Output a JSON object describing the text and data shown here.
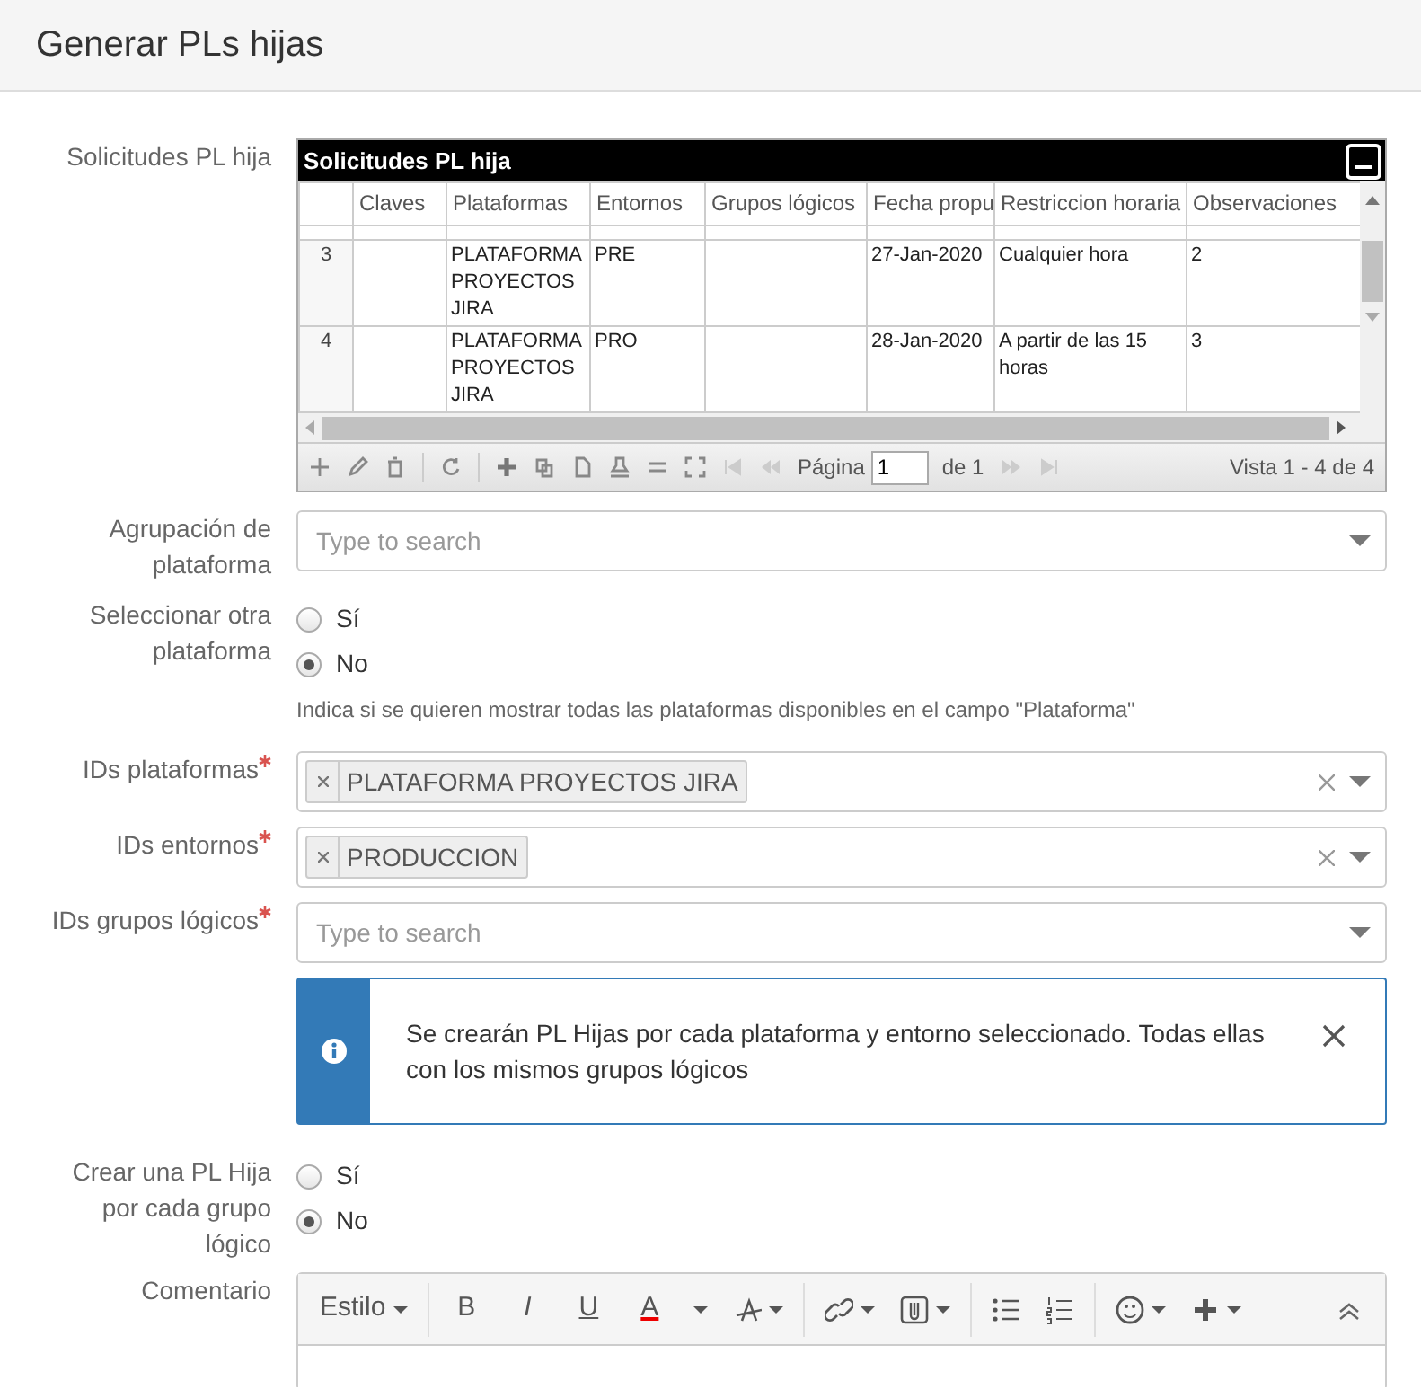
{
  "page_title": "Generar PLs hijas",
  "fields": [
    {
      "kind": "grid",
      "label": "Solicitudes PL hija",
      "required": false,
      "grid": {
        "title": "Solicitudes PL hija",
        "columns": [
          "",
          "Claves",
          "Plataformas",
          "Entornos",
          "Grupos lógicos",
          "Fecha propu",
          "Restriccion horaria",
          "Observaciones"
        ],
        "rows": [
          {
            "cells": [
              "3",
              "",
              "PLATAFORMA PROYECTOS JIRA",
              "PRE",
              "",
              "27-Jan-2020",
              "Cualquier hora",
              "2"
            ]
          },
          {
            "cells": [
              "4",
              "",
              "PLATAFORMA PROYECTOS JIRA",
              "PRO",
              "",
              "28-Jan-2020",
              "A partir de las 15 horas",
              "3"
            ]
          }
        ],
        "pager": {
          "page_label": "Página",
          "page_value": "1",
          "of_label": "de 1",
          "summary": "Vista 1 - 4 de 4"
        }
      }
    },
    {
      "kind": "select",
      "label": "Agrupación de plataforma",
      "required": false,
      "placeholder": "Type to search"
    },
    {
      "kind": "radio",
      "label": "Seleccionar otra plataforma",
      "required": false,
      "options": [
        {
          "label": "Sí",
          "selected": false
        },
        {
          "label": "No",
          "selected": true
        }
      ],
      "help": "Indica si se quieren mostrar todas las plataformas disponibles en el campo \"Plataforma\""
    },
    {
      "kind": "tags",
      "label": "IDs plataformas",
      "required": true,
      "tags": [
        "PLATAFORMA PROYECTOS JIRA"
      ]
    },
    {
      "kind": "tags",
      "label": "IDs entornos",
      "required": true,
      "tags": [
        "PRODUCCION"
      ]
    },
    {
      "kind": "select",
      "label": "IDs grupos lógicos",
      "required": true,
      "placeholder": "Type to search"
    },
    {
      "kind": "alert",
      "required": false,
      "text": "Se crearán PL Hijas por cada plataforma y entorno seleccionado. Todas ellas con los mismos grupos lógicos"
    },
    {
      "kind": "radio",
      "label": "Crear una PL Hija por cada grupo lógico",
      "required": false,
      "options": [
        {
          "label": "Sí",
          "selected": false
        },
        {
          "label": "No",
          "selected": true
        }
      ]
    },
    {
      "kind": "editor",
      "label": "Comentario",
      "required": false,
      "toolbar": [
        {
          "kind": "dropdown",
          "label": "Estilo"
        },
        {
          "kind": "sep"
        },
        {
          "kind": "bold",
          "label": "B"
        },
        {
          "kind": "italic",
          "label": "I"
        },
        {
          "kind": "underline",
          "label": "U"
        },
        {
          "kind": "color",
          "label": "A"
        },
        {
          "kind": "caret"
        },
        {
          "kind": "font-size"
        },
        {
          "kind": "sep"
        },
        {
          "kind": "link"
        },
        {
          "kind": "attach"
        },
        {
          "kind": "sep"
        },
        {
          "kind": "bullets"
        },
        {
          "kind": "numbers"
        },
        {
          "kind": "sep"
        },
        {
          "kind": "emoji"
        },
        {
          "kind": "insert"
        },
        {
          "kind": "collapse"
        }
      ]
    }
  ]
}
